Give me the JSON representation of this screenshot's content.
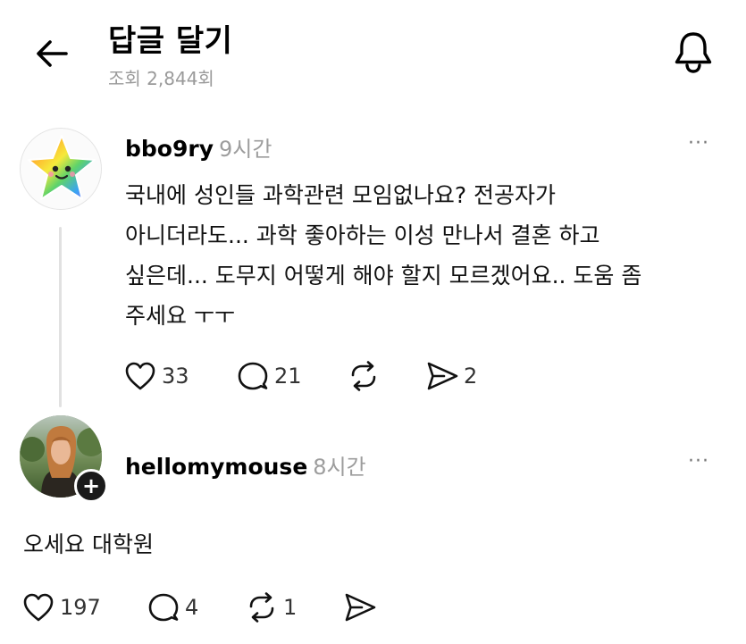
{
  "header": {
    "title": "답글 달기",
    "views": "조회 2,844회"
  },
  "post": {
    "username": "bbo9ry",
    "time": "9시간",
    "body_lines": [
      "국내에 성인들 과학관련 모임없나요? 전공자가",
      "아니더라도... 과학 좋아하는 이성 만나서 결혼 하고",
      "싶은데... 도무지 어떻게 해야 할지 모르겠어요.. 도움 좀",
      "주세요 ㅜㅜ"
    ],
    "likes": "33",
    "comments": "21",
    "shares": "2",
    "more": "···"
  },
  "reply": {
    "username": "hellomymouse",
    "time": "8시간",
    "body": "오세요 대학원",
    "likes": "197",
    "comments": "4",
    "reposts": "1",
    "more": "···",
    "follow_badge": "+"
  },
  "icons": {
    "back": "arrow-left-icon",
    "bell": "bell-icon",
    "like": "heart-icon",
    "comment": "comment-icon",
    "repost": "repost-icon",
    "share": "send-icon"
  }
}
